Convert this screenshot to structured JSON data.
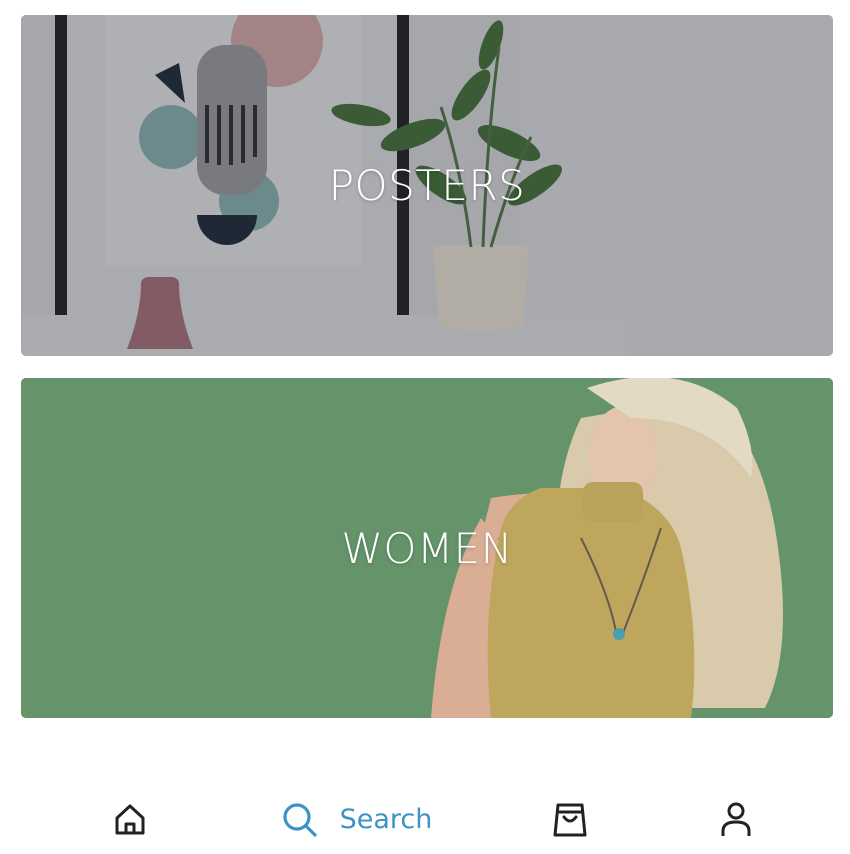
{
  "categories": [
    {
      "label": "POSTERS"
    },
    {
      "label": "WOMEN"
    }
  ],
  "bottom_nav": {
    "home_icon": "home-icon",
    "search_icon": "search-icon",
    "search_label": "Search",
    "cart_icon": "shopping-bag-icon",
    "account_icon": "user-icon",
    "active_color": "#3c93c4",
    "inactive_color": "#222222"
  }
}
